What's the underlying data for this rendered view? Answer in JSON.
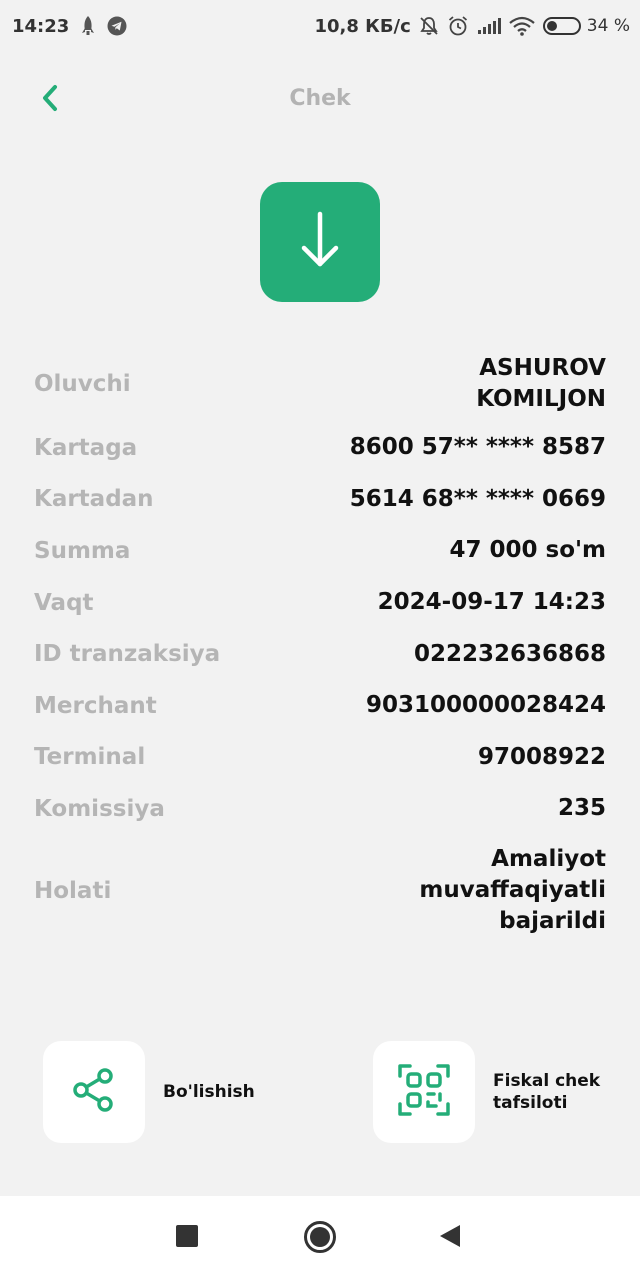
{
  "statusbar": {
    "time": "14:23",
    "speed": "10,8 КБ/с",
    "battery": "34 %",
    "battery_level": 0.34
  },
  "header": {
    "title": "Chek"
  },
  "details": [
    {
      "label": "Oluvchi",
      "value": "ASHUROV KOMILJON"
    },
    {
      "label": "Kartaga",
      "value": "8600 57** **** 8587"
    },
    {
      "label": "Kartadan",
      "value": "5614 68** **** 0669"
    },
    {
      "label": "Summa",
      "value": "47 000 so'm"
    },
    {
      "label": "Vaqt",
      "value": "2024-09-17 14:23"
    },
    {
      "label": "ID tranzaksiya",
      "value": "022232636868"
    },
    {
      "label": "Merchant",
      "value": "903100000028424"
    },
    {
      "label": "Terminal",
      "value": "97008922"
    },
    {
      "label": "Komissiya",
      "value": "235"
    },
    {
      "label": "Holati",
      "value": "Amaliyot muvaffaqiyatli bajarildi"
    }
  ],
  "actions": {
    "share_label": "Bo'lishish",
    "fiscal_label": "Fiskal chek tafsiloti"
  },
  "colors": {
    "accent": "#24ad78",
    "label": "#b5b5b5",
    "background": "#f2f2f2"
  },
  "icons": {
    "back": "chevron-left-icon",
    "status": "arrow-down-icon",
    "share": "share-icon",
    "fiscal": "qr-scan-icon"
  }
}
